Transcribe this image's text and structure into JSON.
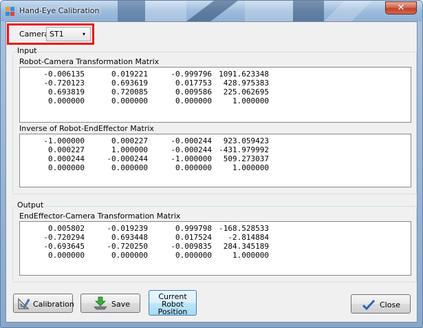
{
  "window": {
    "title": "Hand-Eye Calibration",
    "close_glyph": "✕"
  },
  "camera": {
    "label": "Camera",
    "selected": "ST1",
    "arrow": "▾"
  },
  "input": {
    "title": "Input",
    "robot_camera": {
      "label": "Robot-Camera Transformation Matrix",
      "rows": [
        [
          "-0.006135",
          "0.019221",
          "-0.999796",
          "1091.623348"
        ],
        [
          "-0.720123",
          "0.693619",
          "0.017753",
          "428.975383"
        ],
        [
          "0.693819",
          "0.720085",
          "0.009586",
          "225.062695"
        ],
        [
          "0.000000",
          "0.000000",
          "0.000000",
          "1.000000"
        ]
      ]
    },
    "inverse_end_effector": {
      "label": "Inverse of Robot-EndEffector Matrix",
      "rows": [
        [
          "-1.000000",
          "0.000227",
          "-0.000244",
          "923.059423"
        ],
        [
          "0.000227",
          "1.000000",
          "-0.000244",
          "-431.979992"
        ],
        [
          "0.000244",
          "-0.000244",
          "-1.000000",
          "509.273037"
        ],
        [
          "0.000000",
          "0.000000",
          "0.000000",
          "1.000000"
        ]
      ]
    }
  },
  "output": {
    "title": "Output",
    "end_effector_camera": {
      "label": "EndEffector-Camera Transformation Matrix",
      "rows": [
        [
          "0.005802",
          "-0.019239",
          "0.999798",
          "-168.528533"
        ],
        [
          "-0.720294",
          "0.693448",
          "0.017524",
          "-2.814884"
        ],
        [
          "-0.693645",
          "-0.720250",
          "-0.009835",
          "284.345189"
        ],
        [
          "0.000000",
          "0.000000",
          "0.000000",
          "1.000000"
        ]
      ]
    }
  },
  "buttons": {
    "calibration": "Calibration",
    "save": "Save",
    "current_robot_position": [
      "Current",
      "Robot",
      "Position"
    ],
    "close": "Close"
  }
}
